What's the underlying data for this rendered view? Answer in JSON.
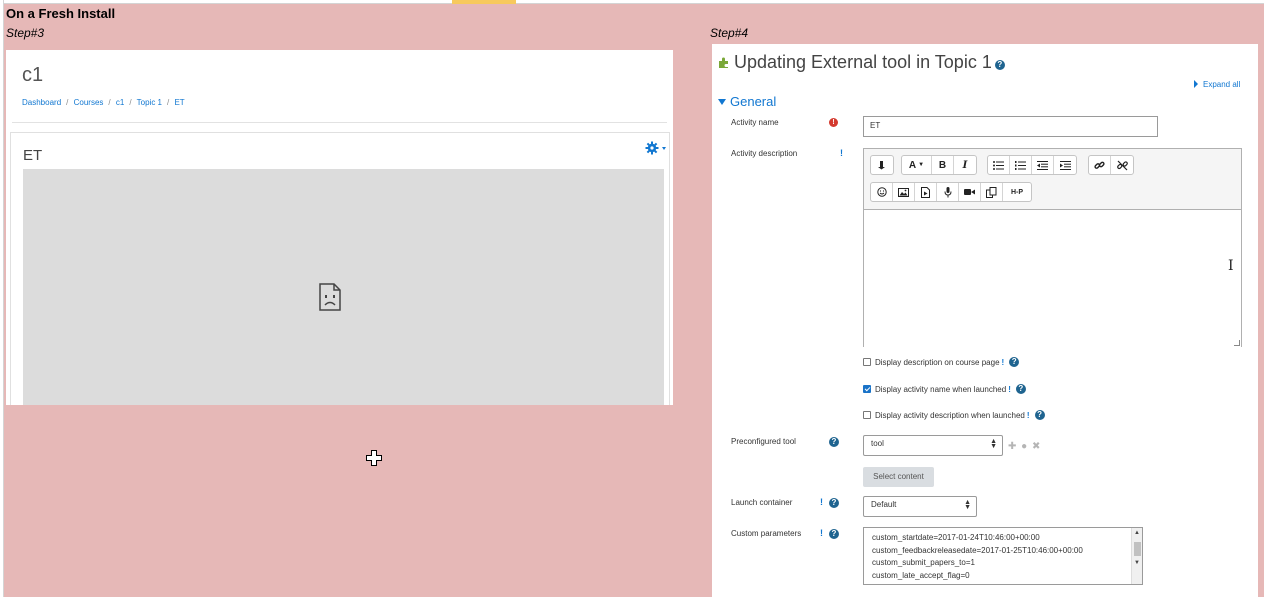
{
  "sheet_title": "On a Fresh Install",
  "step3": {
    "label": "Step#3",
    "course_title": "c1",
    "breadcrumb": [
      "Dashboard",
      "Courses",
      "c1",
      "Topic 1",
      "ET"
    ],
    "breadcrumb_sep": "/",
    "activity_name": "ET",
    "icons": {
      "settings": "gear-icon",
      "broken": "sad-document-icon"
    }
  },
  "step4": {
    "label": "Step#4",
    "heading": "Updating External tool in Topic 1",
    "expand_all": "Expand all",
    "section": "General",
    "fields": {
      "activity_name": {
        "label": "Activity name",
        "value": "ET",
        "required_mark": "!"
      },
      "activity_description": {
        "label": "Activity description",
        "advanced_mark": "!"
      },
      "display_desc": {
        "label": "Display description on course page",
        "checked": false,
        "advanced_mark": "!"
      },
      "display_name": {
        "label": "Display activity name when launched",
        "checked": true,
        "advanced_mark": "!"
      },
      "display_desc_launched": {
        "label": "Display activity description when launched",
        "checked": false,
        "advanced_mark": "!"
      },
      "preconfigured_tool": {
        "label": "Preconfigured tool",
        "value": "tool"
      },
      "select_content": {
        "label": "Select content"
      },
      "launch_container": {
        "label": "Launch container",
        "value": "Default",
        "advanced_mark": "!"
      },
      "custom_parameters": {
        "label": "Custom parameters",
        "advanced_mark": "!",
        "lines": [
          "custom_startdate=2017-01-24T10:46:00+00:00",
          "custom_feedbackreleasedate=2017-01-25T10:46:00+00:00",
          "custom_submit_papers_to=1",
          "custom_late_accept_flag=0"
        ]
      }
    },
    "toolbar_row1": [
      [
        "show-more-icon",
        "↧"
      ]
    ],
    "toolbar_labels": {
      "font": "A",
      "bold": "B",
      "italic": "I",
      "h5p": "H-P"
    },
    "help_glyph": "?"
  },
  "colors": {
    "sheet_bg": "#e6b8b7",
    "link": "#1177d1",
    "help": "#1f6490",
    "required": "#d43a2f"
  }
}
